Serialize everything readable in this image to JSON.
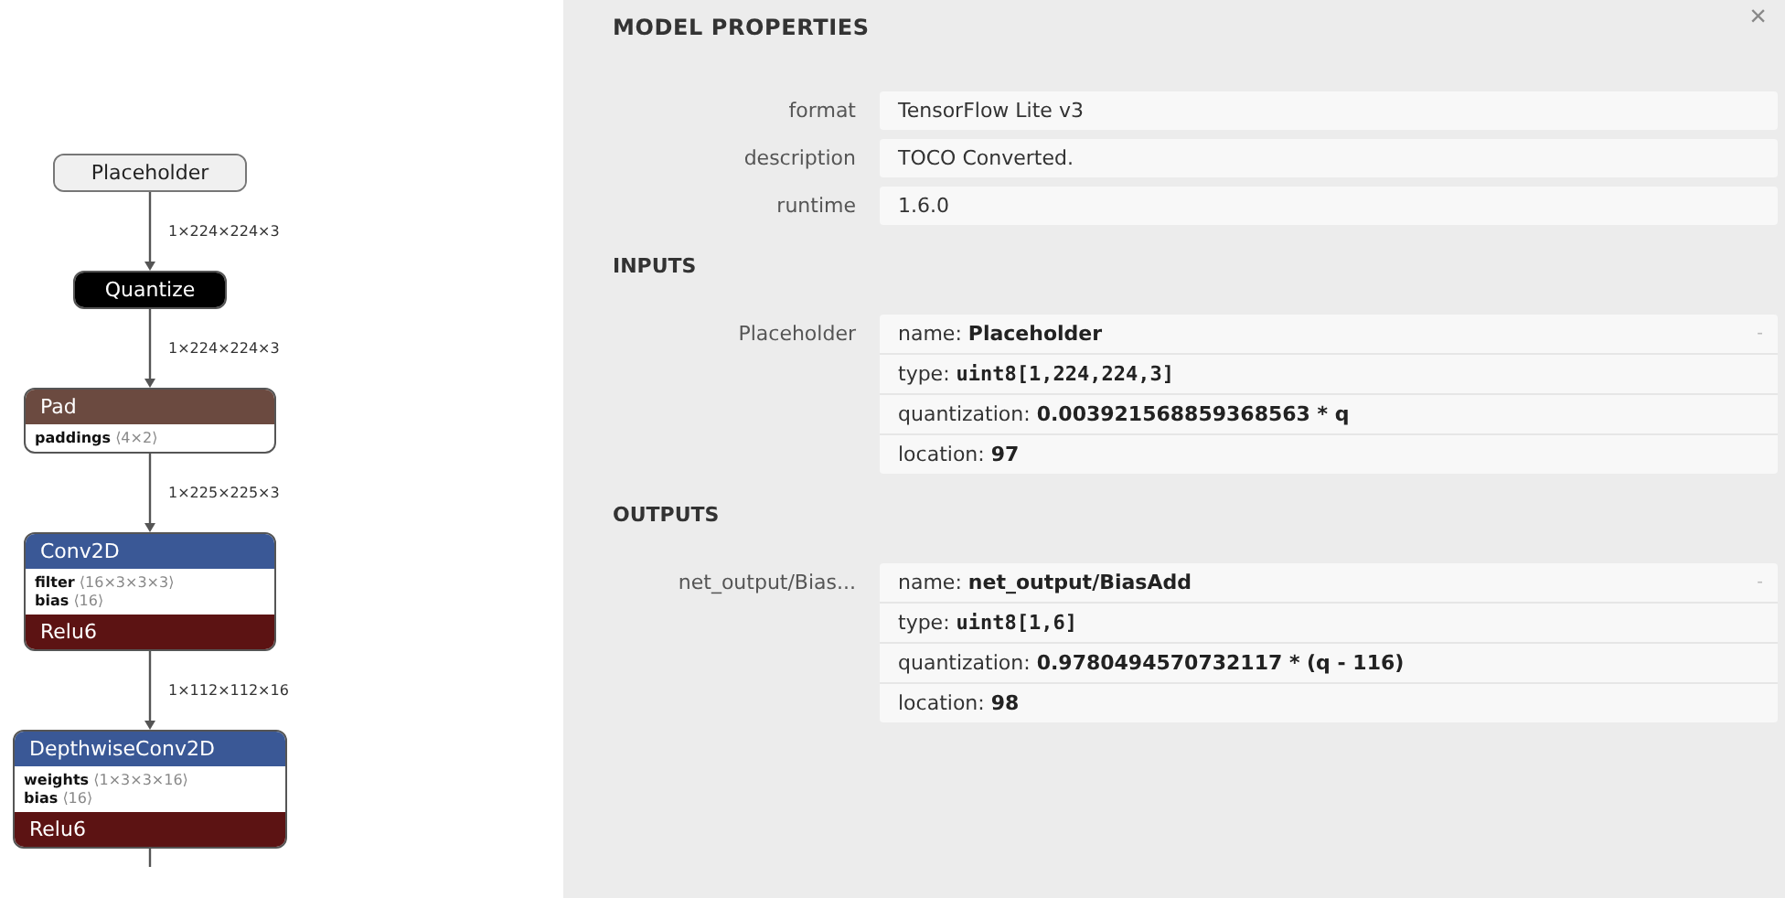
{
  "graph": {
    "nodes": [
      {
        "kind": "input",
        "title": "Placeholder"
      },
      {
        "kind": "quantization",
        "title": "Quantize"
      },
      {
        "kind": "transform",
        "title": "Pad",
        "attributes": [
          {
            "name": "paddings",
            "value": "⟨4×2⟩"
          }
        ]
      },
      {
        "kind": "layer",
        "title": "Conv2D",
        "attributes": [
          {
            "name": "filter",
            "value": "⟨16×3×3×3⟩"
          },
          {
            "name": "bias",
            "value": "⟨16⟩"
          }
        ],
        "activation": "Relu6"
      },
      {
        "kind": "layer",
        "title": "DepthwiseConv2D",
        "attributes": [
          {
            "name": "weights",
            "value": "⟨1×3×3×16⟩"
          },
          {
            "name": "bias",
            "value": "⟨16⟩"
          }
        ],
        "activation": "Relu6"
      }
    ],
    "edges": [
      "1×224×224×3",
      "1×224×224×3",
      "1×225×225×3",
      "1×112×112×16"
    ]
  },
  "panel": {
    "title": "MODEL PROPERTIES",
    "close": "×",
    "properties": [
      {
        "label": "format",
        "value": "TensorFlow Lite v3"
      },
      {
        "label": "description",
        "value": "TOCO Converted."
      },
      {
        "label": "runtime",
        "value": "1.6.0"
      }
    ],
    "sections": [
      {
        "title": "INPUTS",
        "arguments": [
          {
            "label": "Placeholder",
            "toggle": "-",
            "lines": [
              {
                "kind": "text",
                "label": "name:",
                "value": "Placeholder"
              },
              {
                "kind": "code",
                "label": "type:",
                "value": "uint8[1,224,224,3]"
              },
              {
                "kind": "text",
                "label": "quantization:",
                "value": "0.003921568859368563 * q"
              },
              {
                "kind": "text",
                "label": "location:",
                "value": "97"
              }
            ]
          }
        ]
      },
      {
        "title": "OUTPUTS",
        "arguments": [
          {
            "label": "net_output/Bias...",
            "toggle": "-",
            "lines": [
              {
                "kind": "text",
                "label": "name:",
                "value": "net_output/BiasAdd"
              },
              {
                "kind": "code",
                "label": "type:",
                "value": "uint8[1,6]"
              },
              {
                "kind": "text",
                "label": "quantization:",
                "value": "0.9780494570732117 * (q - 116)"
              },
              {
                "kind": "text",
                "label": "location:",
                "value": "98"
              }
            ]
          }
        ]
      }
    ]
  }
}
